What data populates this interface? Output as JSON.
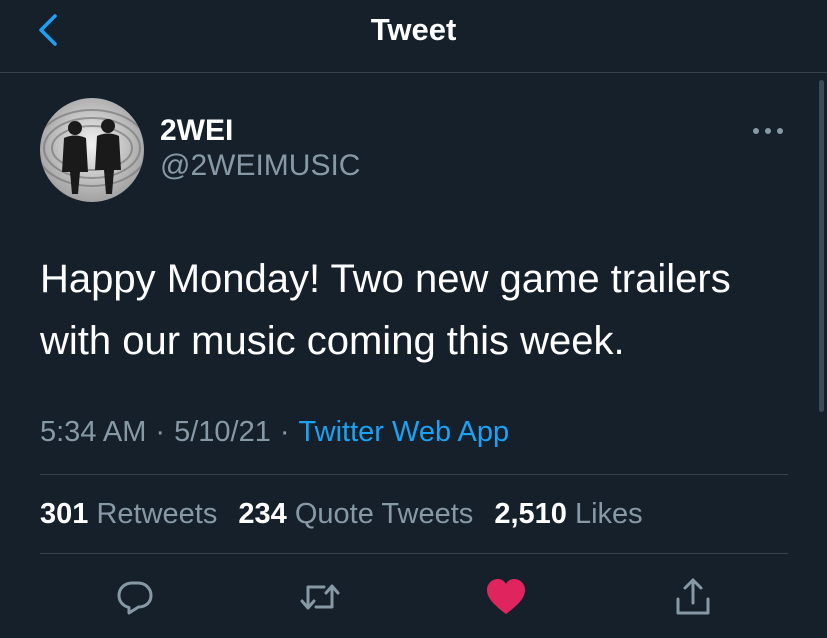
{
  "header": {
    "title": "Tweet",
    "back_icon": "chevron-left-icon",
    "accent_color": "#1da1f2"
  },
  "tweet": {
    "author_name": "2WEI",
    "author_handle": "@2WEIMUSIC",
    "text": "Happy Monday! Two new game trailers with our music coming this week.",
    "time": "5:34 AM",
    "separator": "·",
    "date": "5/10/21",
    "source": "Twitter Web App"
  },
  "stats": {
    "retweets_count": "301",
    "retweets_label": "Retweets",
    "quotes_count": "234",
    "quotes_label": "Quote Tweets",
    "likes_count": "2,510",
    "likes_label": "Likes"
  },
  "actions": {
    "reply_icon": "reply-icon",
    "retweet_icon": "retweet-icon",
    "like_icon": "heart-icon",
    "like_color": "#e0245e",
    "share_icon": "share-icon"
  },
  "colors": {
    "background": "#15202b",
    "secondary_text": "#8899a6",
    "border": "#38444d"
  }
}
